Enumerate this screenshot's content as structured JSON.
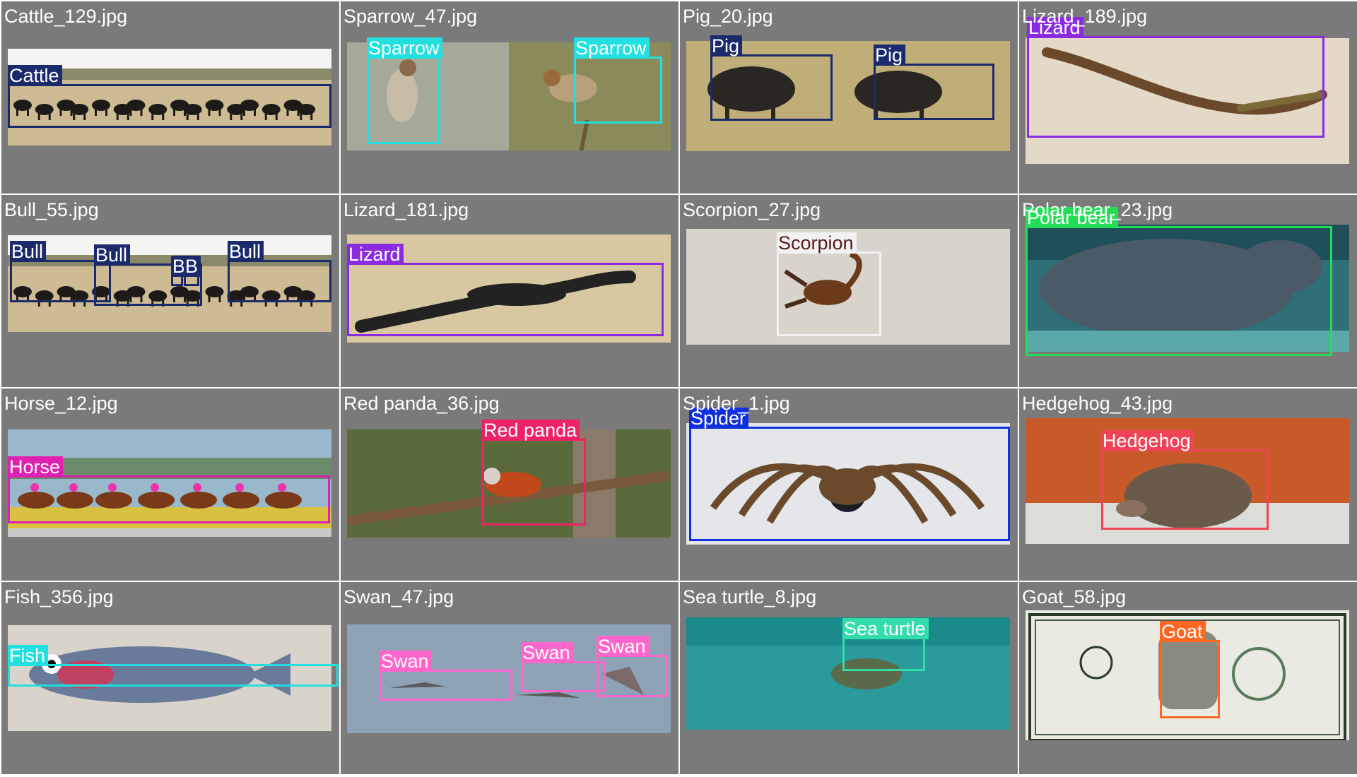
{
  "grid": {
    "background": "#7a7a7a",
    "tiles": [
      {
        "filename": "Cattle_129.jpg",
        "scene": "savanna-herd",
        "detections": [
          {
            "label": "Cattle",
            "color": "#1a2a6b"
          }
        ]
      },
      {
        "filename": "Sparrow_47.jpg",
        "scene": "two-birds",
        "detections": [
          {
            "label": "Sparrow",
            "color": "#22e0e0"
          },
          {
            "label": "Sparrow",
            "color": "#22e0e0"
          }
        ]
      },
      {
        "filename": "Pig_20.jpg",
        "scene": "boars-on-grass",
        "detections": [
          {
            "label": "Pig",
            "color": "#1a2a6b"
          },
          {
            "label": "Pig",
            "color": "#1a2a6b"
          }
        ]
      },
      {
        "filename": "Lizard_189.jpg",
        "scene": "lizard-on-sand",
        "detections": [
          {
            "label": "Lizard",
            "color": "#8a2be2"
          }
        ]
      },
      {
        "filename": "Bull_55.jpg",
        "scene": "savanna-herd",
        "detections": [
          {
            "label": "Bull",
            "color": "#1a2a6b"
          },
          {
            "label": "Bull",
            "color": "#1a2a6b"
          },
          {
            "label": "B",
            "color": "#1a2a6b"
          },
          {
            "label": "B",
            "color": "#1a2a6b"
          },
          {
            "label": "Bull",
            "color": "#1a2a6b"
          }
        ]
      },
      {
        "filename": "Lizard_181.jpg",
        "scene": "monitor-lizard",
        "detections": [
          {
            "label": "Lizard",
            "color": "#8a2be2"
          }
        ]
      },
      {
        "filename": "Scorpion_27.jpg",
        "scene": "scorpion-on-rock",
        "detections": [
          {
            "label": "Scorpion",
            "color": "#f2f2f2"
          }
        ]
      },
      {
        "filename": "Polar bear_23.jpg",
        "scene": "polar-bear-swimming",
        "detections": [
          {
            "label": "Polar bear",
            "color": "#22dd55"
          }
        ]
      },
      {
        "filename": "Horse_12.jpg",
        "scene": "horse-race",
        "detections": [
          {
            "label": "Horse",
            "color": "#e020b0"
          }
        ]
      },
      {
        "filename": "Red panda_36.jpg",
        "scene": "red-panda-on-tree",
        "detections": [
          {
            "label": "Red panda",
            "color": "#ee2266"
          }
        ]
      },
      {
        "filename": "Spider_1.jpg",
        "scene": "tarantula",
        "detections": [
          {
            "label": "Spider",
            "color": "#1030dd"
          }
        ]
      },
      {
        "filename": "Hedgehog_43.jpg",
        "scene": "hedgehog-by-wall",
        "detections": [
          {
            "label": "Hedgehog",
            "color": "#ee4455"
          }
        ]
      },
      {
        "filename": "Fish_356.jpg",
        "scene": "fish-on-sand",
        "detections": [
          {
            "label": "Fish",
            "color": "#22e0e0"
          }
        ]
      },
      {
        "filename": "Swan_47.jpg",
        "scene": "flying-swans",
        "detections": [
          {
            "label": "Swan",
            "color": "#ff66cc"
          },
          {
            "label": "Swan",
            "color": "#ff66cc"
          },
          {
            "label": "Swan",
            "color": "#ff66cc"
          }
        ]
      },
      {
        "filename": "Sea turtle_8.jpg",
        "scene": "sea-turtle-water",
        "detections": [
          {
            "label": "Sea turtle",
            "color": "#33ddaa"
          }
        ]
      },
      {
        "filename": "Goat_58.jpg",
        "scene": "two-dollar-bill",
        "detections": [
          {
            "label": "Goat",
            "color": "#ff6622"
          }
        ]
      }
    ]
  }
}
